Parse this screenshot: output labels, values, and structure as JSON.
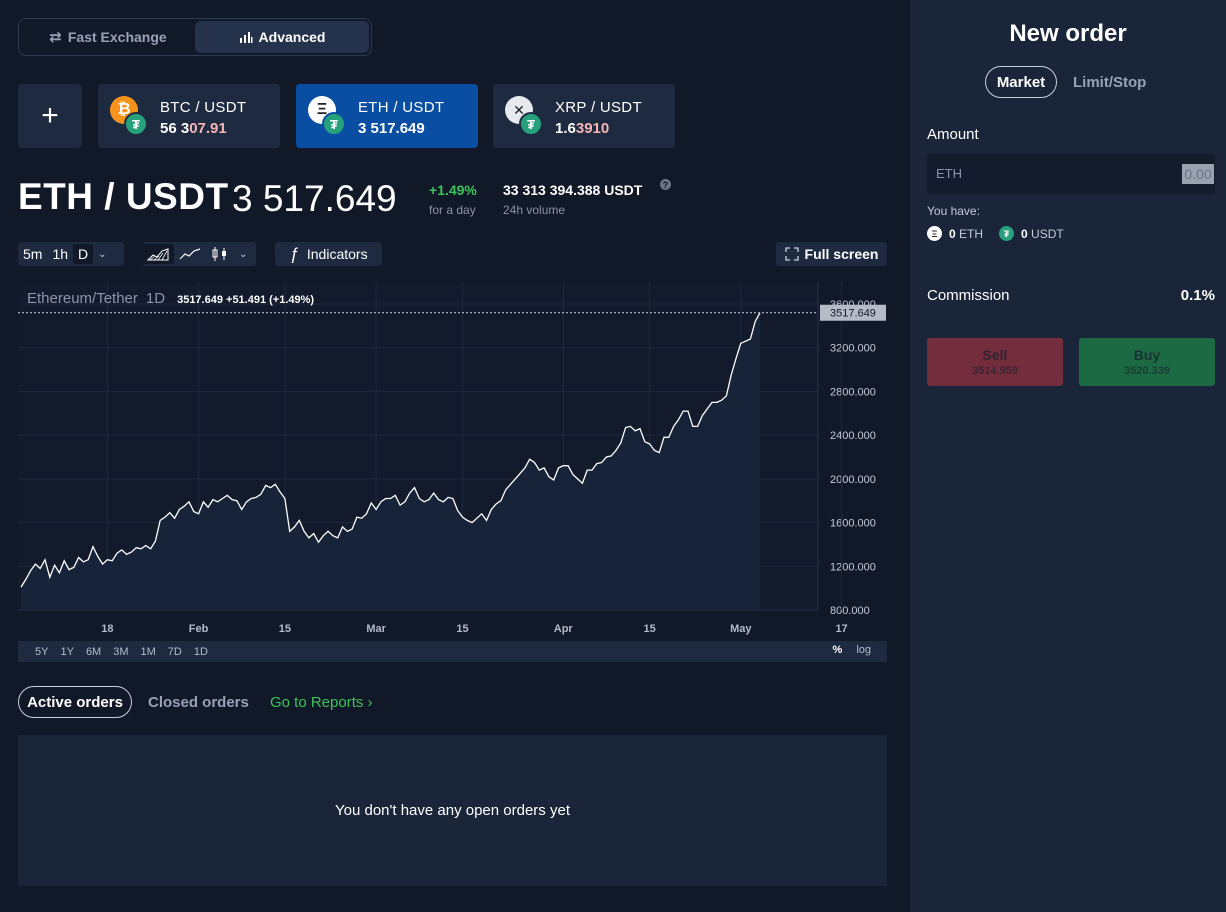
{
  "mode_switch": {
    "fast_exchange": "Fast Exchange",
    "advanced": "Advanced"
  },
  "add_pair_label": "+",
  "pairs": [
    {
      "name": "BTC / USDT",
      "price_prefix": "56 3",
      "price_highlight": "07.91",
      "coin": "₿",
      "coin_color": "#f7931a"
    },
    {
      "name": "ETH / USDT",
      "price": "3 517.649",
      "coin": "Ξ",
      "coin_color": "#ffffff"
    },
    {
      "name": "XRP / USDT",
      "price_prefix": "1.6",
      "price_highlight": "3910",
      "coin": "✕",
      "coin_color": "#e6e9ee"
    }
  ],
  "ticker": {
    "pair": "ETH / USDT",
    "price": "3 517.649",
    "change": "+1.49%",
    "change_label": "for a day",
    "volume": "33 313 394.388 USDT",
    "volume_label": "24h volume",
    "help": "?"
  },
  "toolbar": {
    "intervals": [
      "5m",
      "1h",
      "D"
    ],
    "active_interval": "D",
    "indicators": "Indicators",
    "indicators_glyph": "ƒ",
    "fullscreen": "Full screen"
  },
  "chart_legend": {
    "symbol": "Ethereum/Tether",
    "interval": "1D",
    "ohlc": "3517.649  +51.491 (+1.49%)"
  },
  "chart_data": {
    "type": "area",
    "series": [
      {
        "values": [
          1010,
          1080,
          1160,
          1220,
          1180,
          1260,
          1100,
          1210,
          1140,
          1250,
          1170,
          1190,
          1280,
          1240,
          1260,
          1380,
          1290,
          1220,
          1260,
          1250,
          1320,
          1350,
          1310,
          1330,
          1370,
          1360,
          1390,
          1360,
          1430,
          1620,
          1650,
          1690,
          1640,
          1720,
          1750,
          1790,
          1700,
          1680,
          1790,
          1740,
          1810,
          1790,
          1820,
          1850,
          1810,
          1800,
          1720,
          1790,
          1820,
          1830,
          1860,
          1940,
          1920,
          1950,
          1880,
          1820,
          1520,
          1560,
          1620,
          1520,
          1460,
          1500,
          1420,
          1480,
          1520,
          1480,
          1460,
          1560,
          1520,
          1540,
          1650,
          1640,
          1680,
          1780,
          1720,
          1790,
          1820,
          1820,
          1850,
          1760,
          1790,
          1870,
          1920,
          1820,
          1790,
          1810,
          1870,
          1810,
          1790,
          1830,
          1820,
          1710,
          1650,
          1620,
          1600,
          1640,
          1680,
          1620,
          1720,
          1770,
          1800,
          1900,
          1950,
          2000,
          2050,
          2100,
          2180,
          2150,
          2080,
          2100,
          2020,
          1990,
          2100,
          2120,
          2120,
          2040,
          2000,
          1960,
          2080,
          2080,
          2140,
          2150,
          2200,
          2210,
          2260,
          2330,
          2470,
          2480,
          2440,
          2460,
          2340,
          2320,
          2260,
          2240,
          2380,
          2380,
          2480,
          2540,
          2620,
          2620,
          2480,
          2480,
          2580,
          2640,
          2700,
          2700,
          2720,
          2760,
          2950,
          3100,
          3240,
          3260,
          3280,
          3440,
          3520
        ],
        "sample_points": [
          [
            0,
            1010
          ],
          [
            5,
            1260
          ],
          [
            9,
            1250
          ],
          [
            15,
            1380
          ],
          [
            25,
            1360
          ],
          [
            28,
            1430
          ],
          [
            30,
            1650
          ],
          [
            36,
            1700
          ],
          [
            44,
            1850
          ],
          [
            46,
            1720
          ],
          [
            55,
            1820
          ],
          [
            56,
            1520
          ],
          [
            62,
            1420
          ],
          [
            70,
            1650
          ],
          [
            79,
            1760
          ],
          [
            82,
            1920
          ],
          [
            84,
            1790
          ],
          [
            92,
            1650
          ],
          [
            95,
            1600
          ],
          [
            102,
            1900
          ],
          [
            107,
            2150
          ],
          [
            111,
            1990
          ],
          [
            118,
            2080
          ],
          [
            125,
            2330
          ],
          [
            127,
            2480
          ],
          [
            132,
            2240
          ],
          [
            137,
            2380
          ],
          [
            141,
            2620
          ],
          [
            143,
            2480
          ],
          [
            151,
            2760
          ],
          [
            153,
            3100
          ],
          [
            158,
            3440
          ],
          [
            159,
            3517.649
          ]
        ]
      }
    ],
    "x_ticks": [
      "18",
      "Feb",
      "15",
      "Mar",
      "15",
      "Apr",
      "15",
      "May",
      "17"
    ],
    "y_ticks": [
      "3600.000",
      "3200.000",
      "2800.000",
      "2400.000",
      "2000.000",
      "1600.000",
      "1200.000",
      "800.000"
    ],
    "ylim": [
      800,
      3600
    ],
    "last_value_label": "3517.649",
    "grid": true
  },
  "range_bar": {
    "ranges": [
      "5Y",
      "1Y",
      "6M",
      "3M",
      "1M",
      "7D",
      "1D"
    ],
    "percent": "%",
    "log": "log"
  },
  "orders": {
    "active_tab": "Active orders",
    "closed_tab": "Closed orders",
    "reports_link": "Go to Reports ›",
    "empty_message": "You don't have any open orders yet"
  },
  "new_order": {
    "title": "New order",
    "type_market": "Market",
    "type_limit": "Limit/Stop",
    "amount_label": "Amount",
    "amount_unit": "ETH",
    "amount_value": "0.00",
    "you_have_label": "You have:",
    "balance_eth_value": "0",
    "balance_eth_unit": "ETH",
    "balance_usdt_value": "0",
    "balance_usdt_unit": "USDT",
    "commission_label": "Commission",
    "commission_value": "0.1%",
    "sell_label": "Sell",
    "sell_price": "3514.959",
    "buy_label": "Buy",
    "buy_price": "3520.339"
  },
  "colors": {
    "positive": "#3cc45a",
    "selected_card": "#0a4ea3",
    "sell": "#732d3d",
    "buy": "#1c6a44",
    "tether": "#26a17b"
  }
}
